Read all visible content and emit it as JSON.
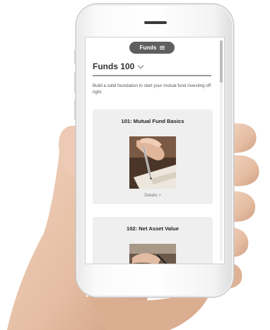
{
  "header": {
    "pill_label": "Funds",
    "menu_icon": "hamburger-menu-icon"
  },
  "page": {
    "title": "Funds 100",
    "intro": "Build a solid foundation to start your mutual fund investing off right."
  },
  "cards": [
    {
      "title": "101: Mutual Fund Basics",
      "link": "Details >"
    },
    {
      "title": "102: Net Asset Value"
    }
  ],
  "colors": {
    "pill_bg": "#5f5f5f",
    "card_bg": "#efefef",
    "skin": "#e7c2a8"
  }
}
